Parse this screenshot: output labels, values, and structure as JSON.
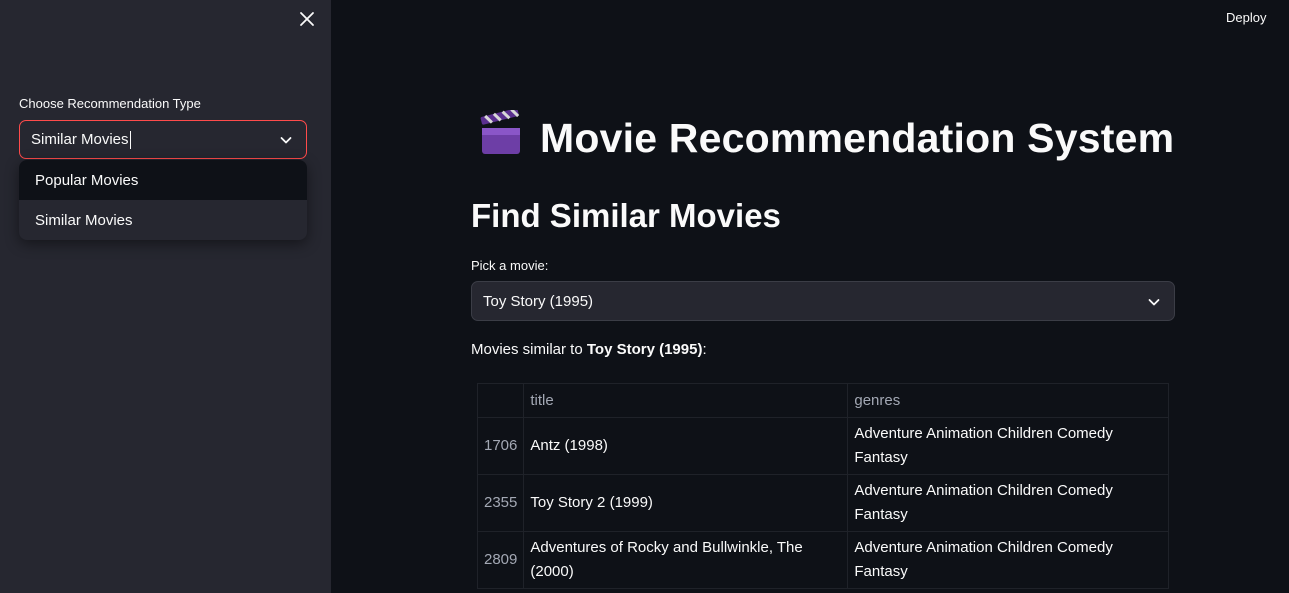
{
  "sidebar": {
    "label": "Choose Recommendation Type",
    "selected_value": "Similar Movies",
    "options": [
      "Popular Movies",
      "Similar Movies"
    ]
  },
  "header": {
    "deploy_label": "Deploy"
  },
  "main": {
    "title": "Movie Recommendation System",
    "subheader": "Find Similar Movies",
    "pick_label": "Pick a movie:",
    "selected_movie": "Toy Story (1995)",
    "similar_prefix": "Movies similar to",
    "similar_movie": "Toy Story (1995)",
    "similar_suffix": ":"
  },
  "table": {
    "columns": [
      "title",
      "genres"
    ],
    "rows": [
      {
        "index": "1706",
        "title": "Antz (1998)",
        "genres": "Adventure Animation Children Comedy Fantasy"
      },
      {
        "index": "2355",
        "title": "Toy Story 2 (1999)",
        "genres": "Adventure Animation Children Comedy Fantasy"
      },
      {
        "index": "2809",
        "title": "Adventures of Rocky and Bullwinkle, The (2000)",
        "genres": "Adventure Animation Children Comedy Fantasy"
      }
    ]
  },
  "colors": {
    "background": "#0e1117",
    "sidebar": "#262730",
    "accent": "#ff4b4b"
  },
  "icons": [
    "close-icon",
    "chevron-down-icon",
    "clapperboard-icon"
  ]
}
